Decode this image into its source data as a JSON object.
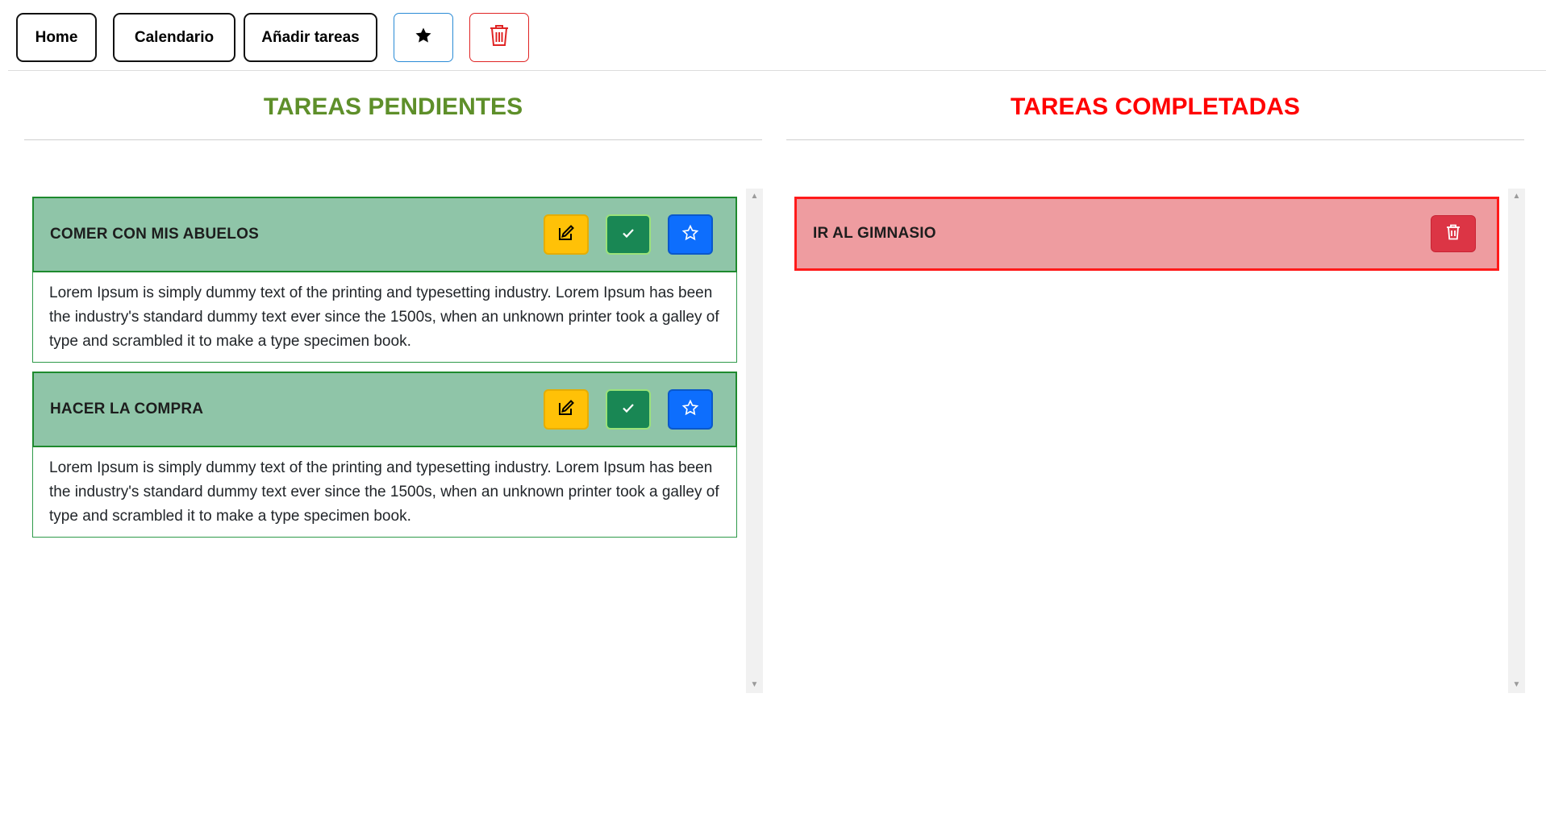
{
  "nav": {
    "home_label": "Home",
    "calendar_label": "Calendario",
    "add_tasks_label": "Añadir tareas",
    "favorites_icon": "star-icon",
    "trash_icon": "trash-icon"
  },
  "pending": {
    "title": "TAREAS PENDIENTES",
    "tasks": [
      {
        "title": "COMER CON MIS ABUELOS",
        "description": "Lorem Ipsum is simply dummy text of the printing and typesetting industry. Lorem Ipsum has been the industry's standard dummy text ever since the 1500s, when an unknown printer took a galley of type and scrambled it to make a type specimen book."
      },
      {
        "title": "HACER LA COMPRA",
        "description": "Lorem Ipsum is simply dummy text of the printing and typesetting industry. Lorem Ipsum has been the industry's standard dummy text ever since the 1500s, when an unknown printer took a galley of type and scrambled it to make a type specimen book."
      }
    ]
  },
  "completed": {
    "title": "TAREAS COMPLETADAS",
    "tasks": [
      {
        "title": "IR AL GIMNASIO"
      }
    ]
  },
  "colors": {
    "pending_title": "#5e8f2a",
    "completed_title": "#ff0000",
    "pending_card": "#8fc5a8",
    "completed_card": "#ee9ca0",
    "edit_button": "#ffc107",
    "done_button": "#198754",
    "favorite_button": "#0d6efd",
    "delete_button": "#dc3545"
  }
}
